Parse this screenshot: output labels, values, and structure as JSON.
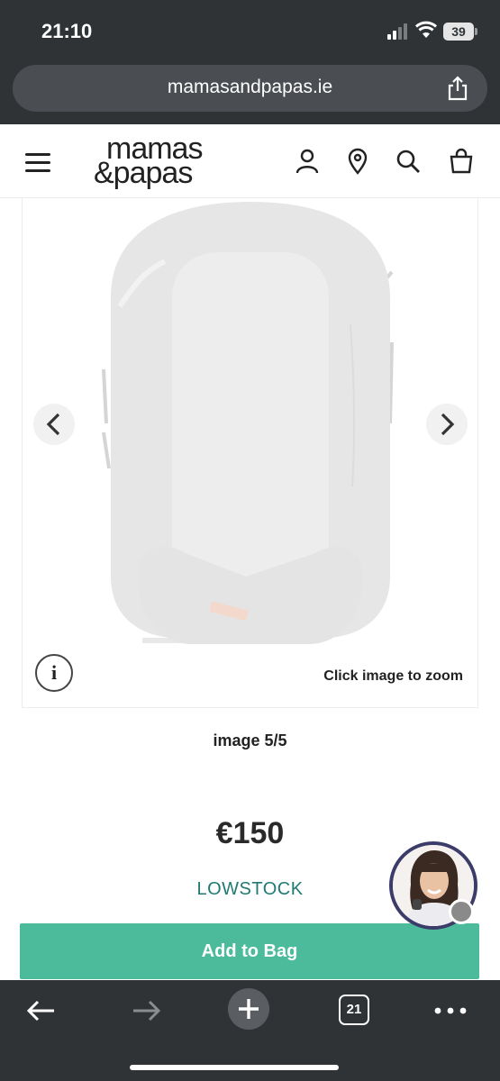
{
  "status": {
    "time": "21:10",
    "battery": "39"
  },
  "browser": {
    "url": "mamasandpapas.ie",
    "tab_count": "21"
  },
  "header": {
    "logo_line1": "mamas",
    "logo_line2": "&papas"
  },
  "product": {
    "zoom_hint": "Click image to zoom",
    "info_label": "i",
    "image_counter": "image 5/5",
    "price": "€150",
    "stock_status": "LOWSTOCK",
    "add_to_bag": "Add to Bag"
  },
  "colors": {
    "accent": "#4cbb9b",
    "stock": "#1f7a73",
    "chrome": "#2f3336"
  }
}
